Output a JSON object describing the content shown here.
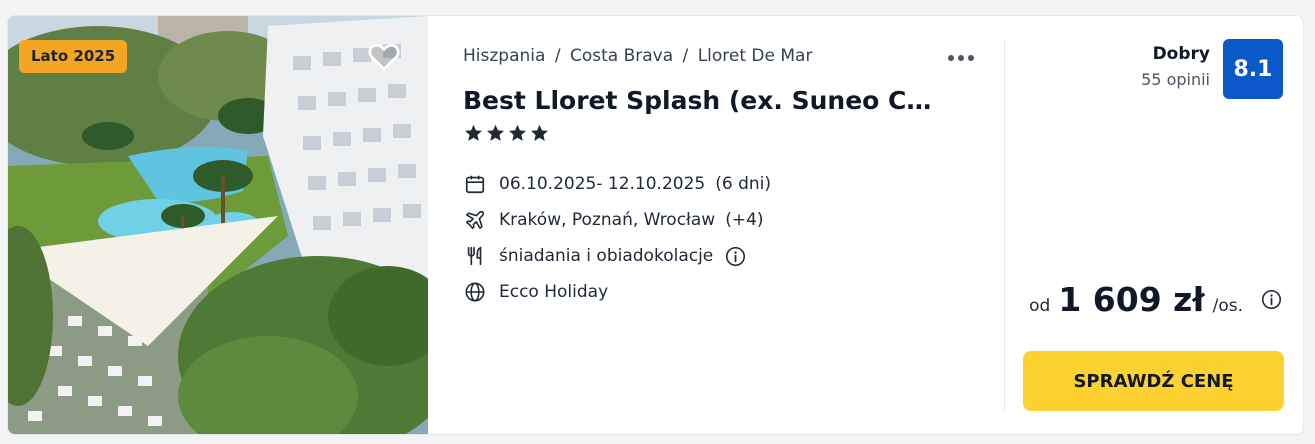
{
  "offer": {
    "badge": "Lato 2025",
    "breadcrumb": [
      "Hiszpania",
      "Costa Brava",
      "Lloret De Mar"
    ],
    "breadcrumb_separator": "/",
    "title": "Best Lloret Splash (ex. Suneo C…",
    "stars": 4,
    "dates": "06.10.2025- 12.10.2025",
    "duration": "(6 dni)",
    "departures": "Kraków, Poznań, Wrocław",
    "departures_more": "(+4)",
    "board": "śniadania i obiadokolacje",
    "operator": "Ecco Holiday"
  },
  "rating": {
    "label": "Dobry",
    "count": "55 opinii",
    "score": "8.1"
  },
  "price": {
    "prefix": "od",
    "amount": "1 609 zł",
    "suffix": "/os."
  },
  "cta": {
    "label": "SPRAWDŹ CENĘ"
  },
  "icons": {
    "favorite": "heart-icon",
    "more": "more-dots-icon",
    "star": "star-icon",
    "dates": "calendar-icon",
    "departures": "plane-icon",
    "board": "fork-knife-icon",
    "operator": "globe-icon",
    "info": "info-icon"
  },
  "colors": {
    "badge_bg": "#f5a524",
    "score_bg": "#0a58ca",
    "cta_bg": "#fdd130",
    "star": "#1f2937"
  }
}
